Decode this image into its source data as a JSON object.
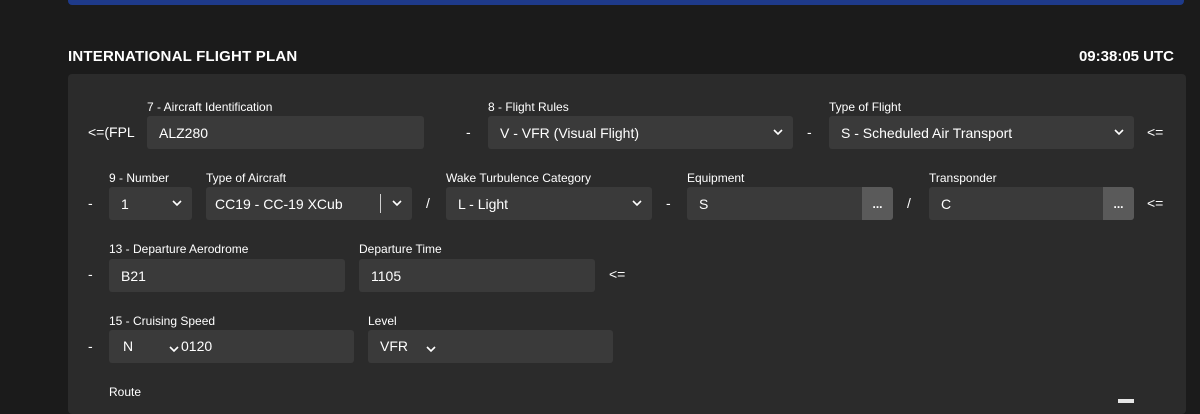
{
  "header": {
    "title": "INTERNATIONAL FLIGHT PLAN",
    "time": "09:38:05 UTC"
  },
  "row1": {
    "prefix": "<=(FPL",
    "aircraft_id_label": "7 - Aircraft Identification",
    "aircraft_id_value": "ALZ280",
    "dash1": "-",
    "flight_rules_label": "8 - Flight Rules",
    "flight_rules_value": "V - VFR (Visual Flight)",
    "dash2": "-",
    "type_of_flight_label": "Type of Flight",
    "type_of_flight_value": "S - Scheduled Air Transport",
    "end": "<="
  },
  "row2": {
    "dash0": "-",
    "number_label": "9 - Number",
    "number_value": "1",
    "aircraft_type_label": "Type of Aircraft",
    "aircraft_type_value": "CC19 - CC-19 XCub",
    "slash1": "/",
    "wake_label": "Wake Turbulence Category",
    "wake_value": "L - Light",
    "dash1": "-",
    "equipment_label": "Equipment",
    "equipment_value": "S",
    "equipment_btn": "...",
    "slash2": "/",
    "transponder_label": "Transponder",
    "transponder_value": "C",
    "transponder_btn": "...",
    "end": "<="
  },
  "row3": {
    "dash0": "-",
    "departure_label": "13 - Departure Aerodrome",
    "departure_value": "B21",
    "dep_time_label": "Departure Time",
    "dep_time_value": "1105",
    "end": "<="
  },
  "row4": {
    "dash0": "-",
    "speed_label": "15 - Cruising Speed",
    "speed_unit": "N",
    "speed_value": "0120",
    "level_label": "Level",
    "level_value": "VFR"
  },
  "row5": {
    "route_label": "Route"
  },
  "colors": {
    "background": "#1b1b1b",
    "panel": "#2b2b2b",
    "field": "#3a3a3a",
    "button": "#5a5a5a",
    "banner": "#1e3a8a"
  }
}
